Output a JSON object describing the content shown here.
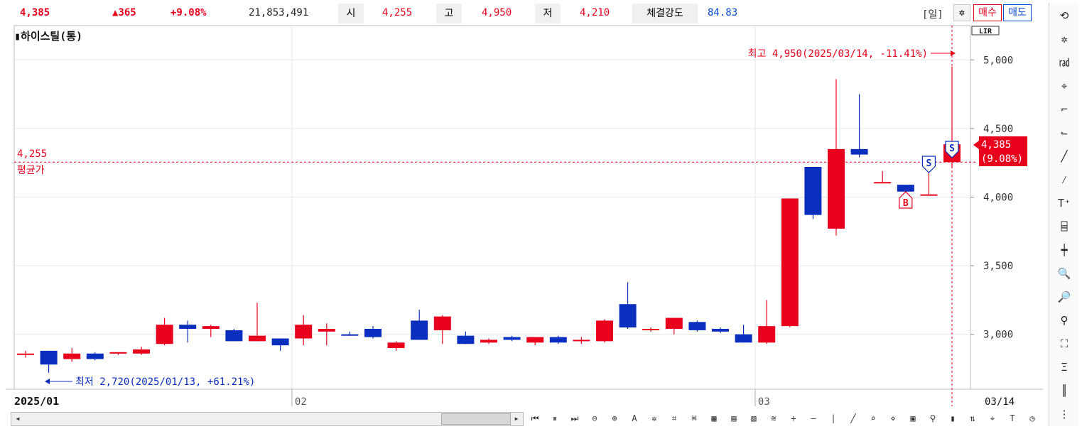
{
  "header": {
    "price": "4,385",
    "change": "▲365",
    "change_pct": "+9.08%",
    "volume": "21,853,491",
    "open_label": "시",
    "open": "4,255",
    "high_label": "고",
    "high": "4,950",
    "low_label": "저",
    "low": "4,210",
    "strength_label": "체결강도",
    "strength": "84.83",
    "period": "[일]",
    "buy_label": "매수",
    "sell_label": "매도",
    "colors": {
      "up": "#e8001c",
      "down": "#0a2fbf",
      "accent": "#0a4ad8"
    }
  },
  "chart": {
    "title": "하이스틸(통)",
    "lir": "LIR",
    "high_annotation": "최고 4,950(2025/03/14, -11.41%)",
    "low_annotation": "최저 2,720(2025/01/13, +61.21%)",
    "avg_value": "4,255",
    "avg_label": "평균가",
    "current_price": "4,385",
    "current_pct": "(9.08%)",
    "x_start": "2025/01",
    "x_end": "03/14",
    "signals": [
      "S",
      "S",
      "B"
    ]
  },
  "chart_data": {
    "type": "candlestick",
    "ylim": [
      2600,
      5250
    ],
    "y_ticks": [
      "3,000",
      "3,500",
      "4,000",
      "4,500",
      "5,000"
    ],
    "y_tick_values": [
      3000,
      3500,
      4000,
      4500,
      5000
    ],
    "x_ticks": [
      "02",
      "03"
    ],
    "x_tick_index": [
      12,
      32
    ],
    "avg_price": 4255,
    "candles": [
      {
        "o": 2850,
        "h": 2880,
        "l": 2830,
        "c": 2860
      },
      {
        "o": 2880,
        "h": 2880,
        "l": 2720,
        "c": 2780
      },
      {
        "o": 2820,
        "h": 2900,
        "l": 2800,
        "c": 2860
      },
      {
        "o": 2860,
        "h": 2870,
        "l": 2810,
        "c": 2820
      },
      {
        "o": 2860,
        "h": 2870,
        "l": 2850,
        "c": 2870
      },
      {
        "o": 2860,
        "h": 2910,
        "l": 2850,
        "c": 2890
      },
      {
        "o": 2930,
        "h": 3120,
        "l": 2920,
        "c": 3070
      },
      {
        "o": 3070,
        "h": 3100,
        "l": 2940,
        "c": 3040
      },
      {
        "o": 3040,
        "h": 3070,
        "l": 2980,
        "c": 3060
      },
      {
        "o": 3030,
        "h": 3040,
        "l": 2950,
        "c": 2950
      },
      {
        "o": 2950,
        "h": 3230,
        "l": 2950,
        "c": 2990
      },
      {
        "o": 2970,
        "h": 2970,
        "l": 2880,
        "c": 2920
      },
      {
        "o": 2970,
        "h": 3140,
        "l": 2920,
        "c": 3070
      },
      {
        "o": 3020,
        "h": 3080,
        "l": 2920,
        "c": 3040
      },
      {
        "o": 3000,
        "h": 3020,
        "l": 2990,
        "c": 2990
      },
      {
        "o": 3040,
        "h": 3060,
        "l": 2970,
        "c": 2980
      },
      {
        "o": 2900,
        "h": 2950,
        "l": 2880,
        "c": 2940
      },
      {
        "o": 3100,
        "h": 3180,
        "l": 2960,
        "c": 2960
      },
      {
        "o": 3030,
        "h": 3140,
        "l": 2930,
        "c": 3130
      },
      {
        "o": 2990,
        "h": 3020,
        "l": 2930,
        "c": 2930
      },
      {
        "o": 2940,
        "h": 2970,
        "l": 2930,
        "c": 2960
      },
      {
        "o": 2980,
        "h": 2990,
        "l": 2950,
        "c": 2960
      },
      {
        "o": 2940,
        "h": 2980,
        "l": 2920,
        "c": 2980
      },
      {
        "o": 2980,
        "h": 2990,
        "l": 2930,
        "c": 2940
      },
      {
        "o": 2950,
        "h": 2980,
        "l": 2930,
        "c": 2960
      },
      {
        "o": 2950,
        "h": 3110,
        "l": 2940,
        "c": 3100
      },
      {
        "o": 3220,
        "h": 3380,
        "l": 3040,
        "c": 3050
      },
      {
        "o": 3040,
        "h": 3050,
        "l": 3020,
        "c": 3040
      },
      {
        "o": 3040,
        "h": 3120,
        "l": 3000,
        "c": 3120
      },
      {
        "o": 3090,
        "h": 3100,
        "l": 3020,
        "c": 3030
      },
      {
        "o": 3040,
        "h": 3050,
        "l": 3010,
        "c": 3020
      },
      {
        "o": 3000,
        "h": 3070,
        "l": 2940,
        "c": 2940
      },
      {
        "o": 2940,
        "h": 3250,
        "l": 2930,
        "c": 3060
      },
      {
        "o": 3060,
        "h": 3990,
        "l": 3050,
        "c": 3990
      },
      {
        "o": 4220,
        "h": 4220,
        "l": 3840,
        "c": 3870
      },
      {
        "o": 3770,
        "h": 4860,
        "l": 3720,
        "c": 4350
      },
      {
        "o": 4350,
        "h": 4750,
        "l": 4290,
        "c": 4310
      },
      {
        "o": 4100,
        "h": 4190,
        "l": 4100,
        "c": 4110
      },
      {
        "o": 4090,
        "h": 4090,
        "l": 4030,
        "c": 4040
      },
      {
        "o": 4020,
        "h": 4240,
        "l": 4020,
        "c": 4020
      },
      {
        "o": 4255,
        "h": 4950,
        "l": 4210,
        "c": 4385
      }
    ]
  },
  "toolbar_right": [
    {
      "name": "refresh-icon",
      "glyph": "⟲"
    },
    {
      "name": "gear-icon",
      "glyph": "✲"
    },
    {
      "name": "indicator-icon",
      "glyph": "㎭"
    },
    {
      "name": "crosshair-icon",
      "glyph": "⌖"
    },
    {
      "name": "hline-icon",
      "glyph": "⌐"
    },
    {
      "name": "vline-icon",
      "glyph": "⌙"
    },
    {
      "name": "trendline-icon",
      "glyph": "╱"
    },
    {
      "name": "auto-icon",
      "glyph": "⁄"
    },
    {
      "name": "text-icon",
      "glyph": "T⁺"
    },
    {
      "name": "pattern-icon",
      "glyph": "⌸"
    },
    {
      "name": "candle-icon",
      "glyph": "┿"
    },
    {
      "name": "zoom-in-icon",
      "glyph": "🔍"
    },
    {
      "name": "zoom-out-icon",
      "glyph": "🔎"
    },
    {
      "name": "analysis-icon",
      "glyph": "⚲"
    },
    {
      "name": "figure-icon",
      "glyph": "⛶"
    },
    {
      "name": "fibo-icon",
      "glyph": "Ξ"
    },
    {
      "name": "bars-icon",
      "glyph": "║"
    },
    {
      "name": "more-icon",
      "glyph": "⋮"
    }
  ],
  "bottom_toolbar": [
    "⏮",
    "⏸",
    "⏭",
    "⊖",
    "⊕",
    "A",
    "✲",
    "⌗",
    "⌘",
    "▦",
    "▤",
    "▧",
    "≋",
    "+",
    "—",
    "|",
    "╱",
    "⌕",
    "⋄",
    "▣",
    "⚲",
    "▮",
    "⇅",
    "⌖",
    "T",
    "◷"
  ]
}
